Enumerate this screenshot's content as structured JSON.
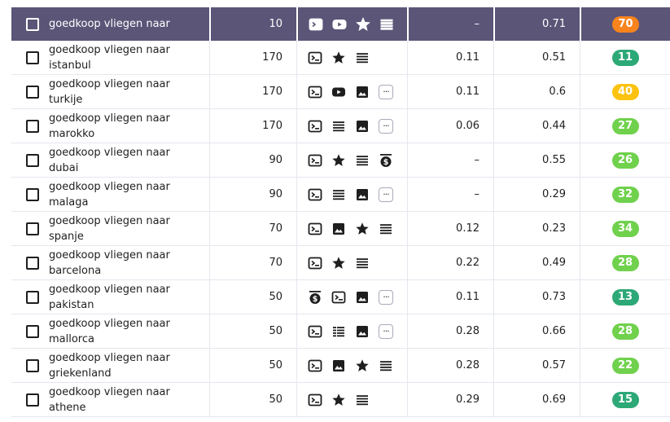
{
  "rows": [
    {
      "keyword": "goedkoop vliegen naar",
      "volume": "10",
      "features": [
        "sitelinks",
        "video",
        "star",
        "list"
      ],
      "cpc": "–",
      "competition": "0.71",
      "kd": "70",
      "kd_color": "#f9841d",
      "header": true
    },
    {
      "keyword": "goedkoop vliegen naar\nistanbul",
      "volume": "170",
      "features": [
        "sitelinks",
        "star",
        "list"
      ],
      "cpc": "0.11",
      "competition": "0.51",
      "kd": "11",
      "kd_color": "#2da877"
    },
    {
      "keyword": "goedkoop vliegen naar\nturkije",
      "volume": "170",
      "features": [
        "sitelinks",
        "video",
        "image",
        "more"
      ],
      "cpc": "0.11",
      "competition": "0.6",
      "kd": "40",
      "kd_color": "#fbc310"
    },
    {
      "keyword": "goedkoop vliegen naar\nmarokko",
      "volume": "170",
      "features": [
        "sitelinks",
        "list",
        "image",
        "more"
      ],
      "cpc": "0.06",
      "competition": "0.44",
      "kd": "27",
      "kd_color": "#70d14d"
    },
    {
      "keyword": "goedkoop vliegen naar\ndubai",
      "volume": "90",
      "features": [
        "sitelinks",
        "star",
        "list",
        "ad"
      ],
      "cpc": "–",
      "competition": "0.55",
      "kd": "26",
      "kd_color": "#70d14d"
    },
    {
      "keyword": "goedkoop vliegen naar\nmalaga",
      "volume": "90",
      "features": [
        "sitelinks",
        "list",
        "image",
        "more"
      ],
      "cpc": "–",
      "competition": "0.29",
      "kd": "32",
      "kd_color": "#70d14d"
    },
    {
      "keyword": "goedkoop vliegen naar\nspanje",
      "volume": "70",
      "features": [
        "sitelinks",
        "image",
        "star",
        "list"
      ],
      "cpc": "0.12",
      "competition": "0.23",
      "kd": "34",
      "kd_color": "#70d14d"
    },
    {
      "keyword": "goedkoop vliegen naar\nbarcelona",
      "volume": "70",
      "features": [
        "sitelinks",
        "star",
        "list"
      ],
      "cpc": "0.22",
      "competition": "0.49",
      "kd": "28",
      "kd_color": "#70d14d"
    },
    {
      "keyword": "goedkoop vliegen naar\npakistan",
      "volume": "50",
      "features": [
        "ad",
        "sitelinks",
        "image",
        "more"
      ],
      "cpc": "0.11",
      "competition": "0.73",
      "kd": "13",
      "kd_color": "#2da877"
    },
    {
      "keyword": "goedkoop vliegen naar\nmallorca",
      "volume": "50",
      "features": [
        "sitelinks",
        "table",
        "image",
        "more"
      ],
      "cpc": "0.28",
      "competition": "0.66",
      "kd": "28",
      "kd_color": "#70d14d"
    },
    {
      "keyword": "goedkoop vliegen naar\ngriekenland",
      "volume": "50",
      "features": [
        "sitelinks",
        "image",
        "star",
        "list"
      ],
      "cpc": "0.28",
      "competition": "0.57",
      "kd": "22",
      "kd_color": "#70d14d"
    },
    {
      "keyword": "goedkoop vliegen naar\nathene",
      "volume": "50",
      "features": [
        "sitelinks",
        "star",
        "list"
      ],
      "cpc": "0.29",
      "competition": "0.69",
      "kd": "15",
      "kd_color": "#2da877"
    }
  ],
  "more_label": "···"
}
